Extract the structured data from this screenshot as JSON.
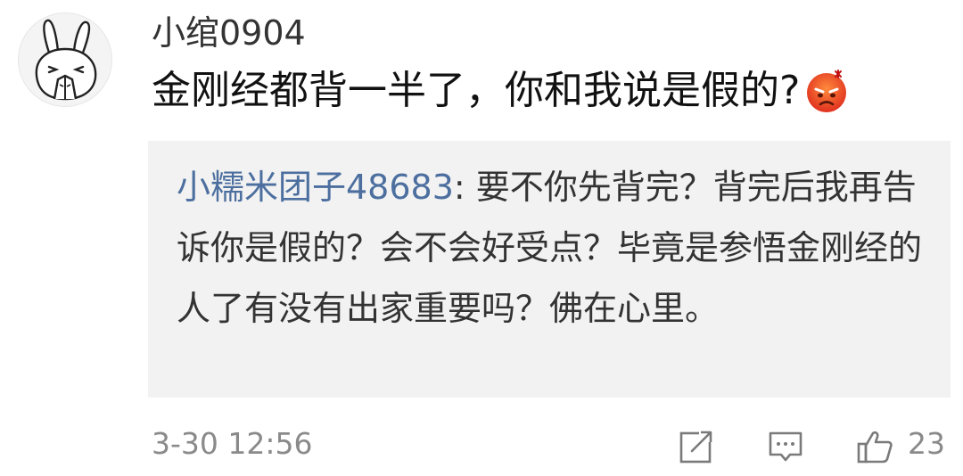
{
  "comment": {
    "username": "小绾0904",
    "text": "金刚经都背一半了，你和我说是假的?",
    "emoji_icon": "angry-face-icon",
    "avatar_icon": "bunny-avatar-icon"
  },
  "reply": {
    "author": "小糯米团子48683",
    "separator": ": ",
    "text": "要不你先背完？背完后我再告诉你是假的？会不会好受点？毕竟是参悟金刚经的人了有没有出家重要吗？佛在心里。"
  },
  "footer": {
    "timestamp": "3-30 12:56",
    "share_icon": "share-icon",
    "comment_icon": "comment-icon",
    "like_icon": "thumbs-up-icon",
    "like_count": "23"
  },
  "colors": {
    "author_link": "#4c6f9f",
    "reply_background": "#f2f2f2",
    "meta_gray": "#8a8a8a"
  }
}
